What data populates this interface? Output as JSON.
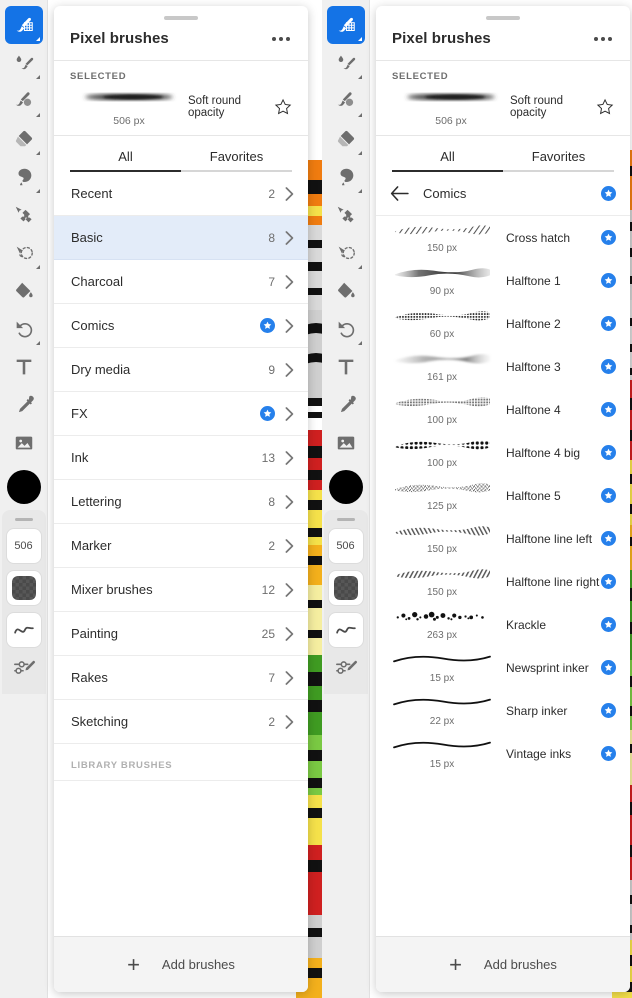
{
  "app": {
    "accent_blue": "#1473e6",
    "star_blue": "#2680eb",
    "selected_row_bg": "#e3ecf9"
  },
  "toolbar": {
    "tools": [
      {
        "name": "pixel-brush-tool",
        "label": "Pixel brush",
        "active": true,
        "has_corner": true
      },
      {
        "name": "live-brush-tool",
        "label": "Live brush",
        "active": false,
        "has_corner": true
      },
      {
        "name": "mixer-brush-tool",
        "label": "Mixer brush",
        "active": false,
        "has_corner": true
      },
      {
        "name": "eraser-tool",
        "label": "Eraser",
        "active": false,
        "has_corner": true
      },
      {
        "name": "smudge-tool",
        "label": "Smudge",
        "active": false,
        "has_corner": true
      },
      {
        "name": "transform-tool",
        "label": "Transform",
        "active": false,
        "has_corner": false
      },
      {
        "name": "lasso-select-tool",
        "label": "Lasso select",
        "active": false,
        "has_corner": true
      },
      {
        "name": "paint-bucket-tool",
        "label": "Paint bucket",
        "active": false,
        "has_corner": false
      },
      {
        "name": "undo-tool",
        "label": "Undo",
        "active": false,
        "has_corner": true
      },
      {
        "name": "text-tool",
        "label": "Text",
        "active": false,
        "has_corner": false
      },
      {
        "name": "eyedropper-tool",
        "label": "Eyedropper",
        "active": false,
        "has_corner": false
      },
      {
        "name": "place-image-tool",
        "label": "Place image",
        "active": false,
        "has_corner": false
      }
    ],
    "color_swatch": "#000000",
    "brush_size_chip": "506",
    "opacity_chip_label": "opacity-checker",
    "flow_chip_label": "smoothing-curve",
    "settings_label": "brush-settings"
  },
  "panel": {
    "title": "Pixel brushes",
    "overflow_label": "More options",
    "selected": {
      "section_label": "SELECTED",
      "size": "506 px",
      "name": "Soft round opacity",
      "favorite": false
    },
    "tabs": [
      {
        "label": "All",
        "selected": true
      },
      {
        "label": "Favorites",
        "selected": false
      }
    ],
    "categories": [
      {
        "name": "Recent",
        "count": "2",
        "favorite": false,
        "selected": false
      },
      {
        "name": "Basic",
        "count": "8",
        "favorite": false,
        "selected": true
      },
      {
        "name": "Charcoal",
        "count": "7",
        "favorite": false,
        "selected": false
      },
      {
        "name": "Comics",
        "count": "",
        "favorite": true,
        "selected": false
      },
      {
        "name": "Dry media",
        "count": "9",
        "favorite": false,
        "selected": false
      },
      {
        "name": "FX",
        "count": "",
        "favorite": true,
        "selected": false
      },
      {
        "name": "Ink",
        "count": "13",
        "favorite": false,
        "selected": false
      },
      {
        "name": "Lettering",
        "count": "8",
        "favorite": false,
        "selected": false
      },
      {
        "name": "Marker",
        "count": "2",
        "favorite": false,
        "selected": false
      },
      {
        "name": "Mixer brushes",
        "count": "12",
        "favorite": false,
        "selected": false
      },
      {
        "name": "Painting",
        "count": "25",
        "favorite": false,
        "selected": false
      },
      {
        "name": "Rakes",
        "count": "7",
        "favorite": false,
        "selected": false
      },
      {
        "name": "Sketching",
        "count": "2",
        "favorite": false,
        "selected": false
      }
    ],
    "library_label": "LIBRARY BRUSHES",
    "footer": {
      "add_label": "Add brushes",
      "plus": "+"
    }
  },
  "detail": {
    "title": "Comics",
    "back_label": "Back",
    "favorite": true,
    "brushes": [
      {
        "name": "Cross hatch",
        "size": "150 px",
        "favorite": true,
        "style": "hatch"
      },
      {
        "name": "Halftone 1",
        "size": "90 px",
        "favorite": true,
        "style": "solid-grain"
      },
      {
        "name": "Halftone 2",
        "size": "60 px",
        "favorite": true,
        "style": "dots-fine"
      },
      {
        "name": "Halftone 3",
        "size": "161 px",
        "favorite": true,
        "style": "soft-wave"
      },
      {
        "name": "Halftone 4",
        "size": "100 px",
        "favorite": true,
        "style": "pixel-blur"
      },
      {
        "name": "Halftone 4 big",
        "size": "100 px",
        "favorite": true,
        "style": "dots-big"
      },
      {
        "name": "Halftone 5",
        "size": "125 px",
        "favorite": true,
        "style": "noise"
      },
      {
        "name": "Halftone line left",
        "size": "150 px",
        "favorite": true,
        "style": "line-left"
      },
      {
        "name": "Halftone line right",
        "size": "150 px",
        "favorite": true,
        "style": "line-right"
      },
      {
        "name": "Krackle",
        "size": "263 px",
        "favorite": true,
        "style": "krackle"
      },
      {
        "name": "Newsprint inker",
        "size": "15 px",
        "favorite": true,
        "style": "thin-ink"
      },
      {
        "name": "Sharp inker",
        "size": "22 px",
        "favorite": true,
        "style": "thin-ink"
      },
      {
        "name": "Vintage inks",
        "size": "15 px",
        "favorite": true,
        "style": "thin-ink"
      }
    ]
  }
}
